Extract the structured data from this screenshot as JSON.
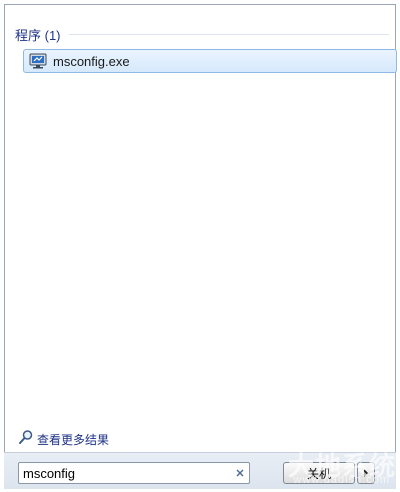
{
  "results": {
    "section_title": "程序 (1)",
    "items": [
      {
        "label": "msconfig.exe",
        "icon": "system-config-icon"
      }
    ]
  },
  "more_results": {
    "label": "查看更多结果",
    "icon": "search-icon"
  },
  "search": {
    "value": "msconfig",
    "clear_icon": "close-icon"
  },
  "shutdown": {
    "label": "关机",
    "options_icon": "chevron-right-icon"
  },
  "watermark": {
    "text": "大地系统",
    "sub": "www.dadish.com"
  },
  "colors": {
    "header_text": "#1e3287",
    "selection_bg": "#d6e9fc",
    "selection_border": "#8fb8e6",
    "footer_bg": "#dce4ee"
  }
}
